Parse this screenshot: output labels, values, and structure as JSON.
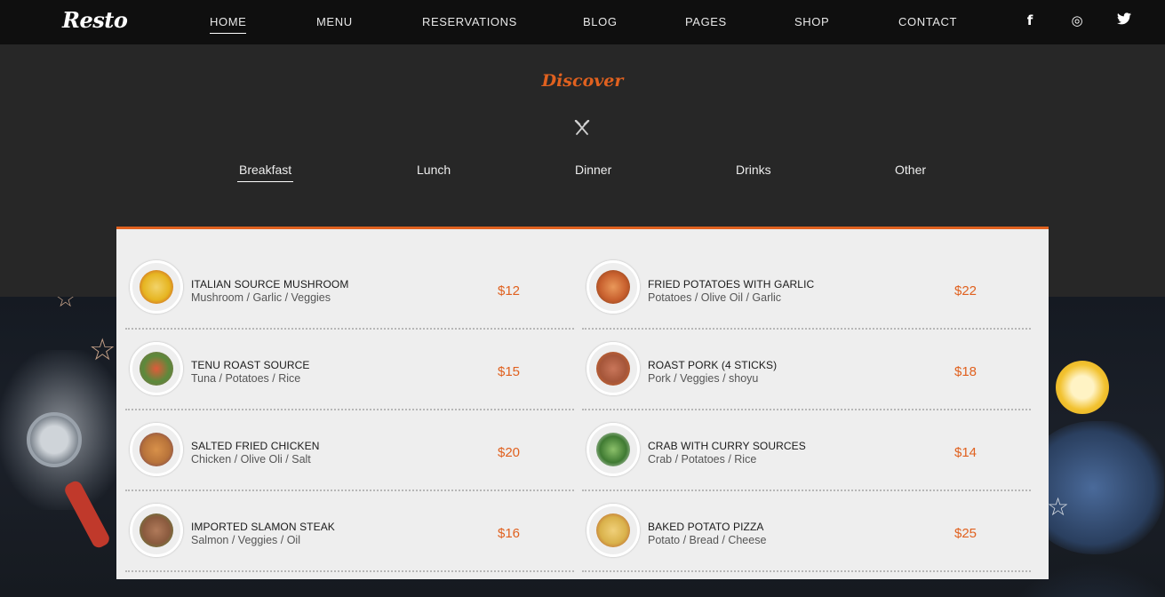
{
  "header": {
    "logo": "Resto",
    "nav": [
      {
        "label": "HOME",
        "active": true
      },
      {
        "label": "MENU",
        "active": false
      },
      {
        "label": "RESERVATIONS",
        "active": false
      },
      {
        "label": "BLOG",
        "active": false
      },
      {
        "label": "PAGES",
        "active": false
      },
      {
        "label": "SHOP",
        "active": false
      },
      {
        "label": "CONTACT",
        "active": false
      }
    ],
    "social": [
      {
        "icon": "facebook-icon",
        "glyph": "f"
      },
      {
        "icon": "instagram-icon",
        "glyph": "◎"
      },
      {
        "icon": "twitter-icon",
        "glyph": "🐦"
      }
    ]
  },
  "section": {
    "kicker": "Discover",
    "tabs": [
      {
        "label": "Breakfast",
        "active": true
      },
      {
        "label": "Lunch",
        "active": false
      },
      {
        "label": "Dinner",
        "active": false
      },
      {
        "label": "Drinks",
        "active": false
      },
      {
        "label": "Other",
        "active": false
      }
    ]
  },
  "menu": {
    "items": [
      {
        "name": "ITALIAN SOURCE MUSHROOM",
        "ingredients": "Mushroom / Garlic / Veggies",
        "price": "$12",
        "color": "#e6b521"
      },
      {
        "name": "FRIED POTATOES WITH GARLIC",
        "ingredients": "Potatoes / Olive Oil / Garlic",
        "price": "$22",
        "color": "#c8602e"
      },
      {
        "name": "TENU ROAST SOURCE",
        "ingredients": "Tuna / Potatoes / Rice",
        "price": "$15",
        "color": "#5a8a3b"
      },
      {
        "name": "ROAST PORK (4 STICKS)",
        "ingredients": "Pork / Veggies / shoyu",
        "price": "$18",
        "color": "#a5563a"
      },
      {
        "name": "SALTED FRIED CHICKEN",
        "ingredients": "Chicken / Olive Oli / Salt",
        "price": "$20",
        "color": "#b8733a"
      },
      {
        "name": "CRAB WITH CURRY SOURCES",
        "ingredients": "Crab / Potatoes / Rice",
        "price": "$14",
        "color": "#3f7a32"
      },
      {
        "name": "IMPORTED SLAMON STEAK",
        "ingredients": "Salmon / Veggies / Oil",
        "price": "$16",
        "color": "#8a5a3e"
      },
      {
        "name": "BAKED POTATO PIZZA",
        "ingredients": "Potato / Bread / Cheese",
        "price": "$25",
        "color": "#d9b14a"
      }
    ]
  },
  "colors": {
    "accent": "#e0611f",
    "dark": "#272727",
    "card": "#eeeeee"
  }
}
